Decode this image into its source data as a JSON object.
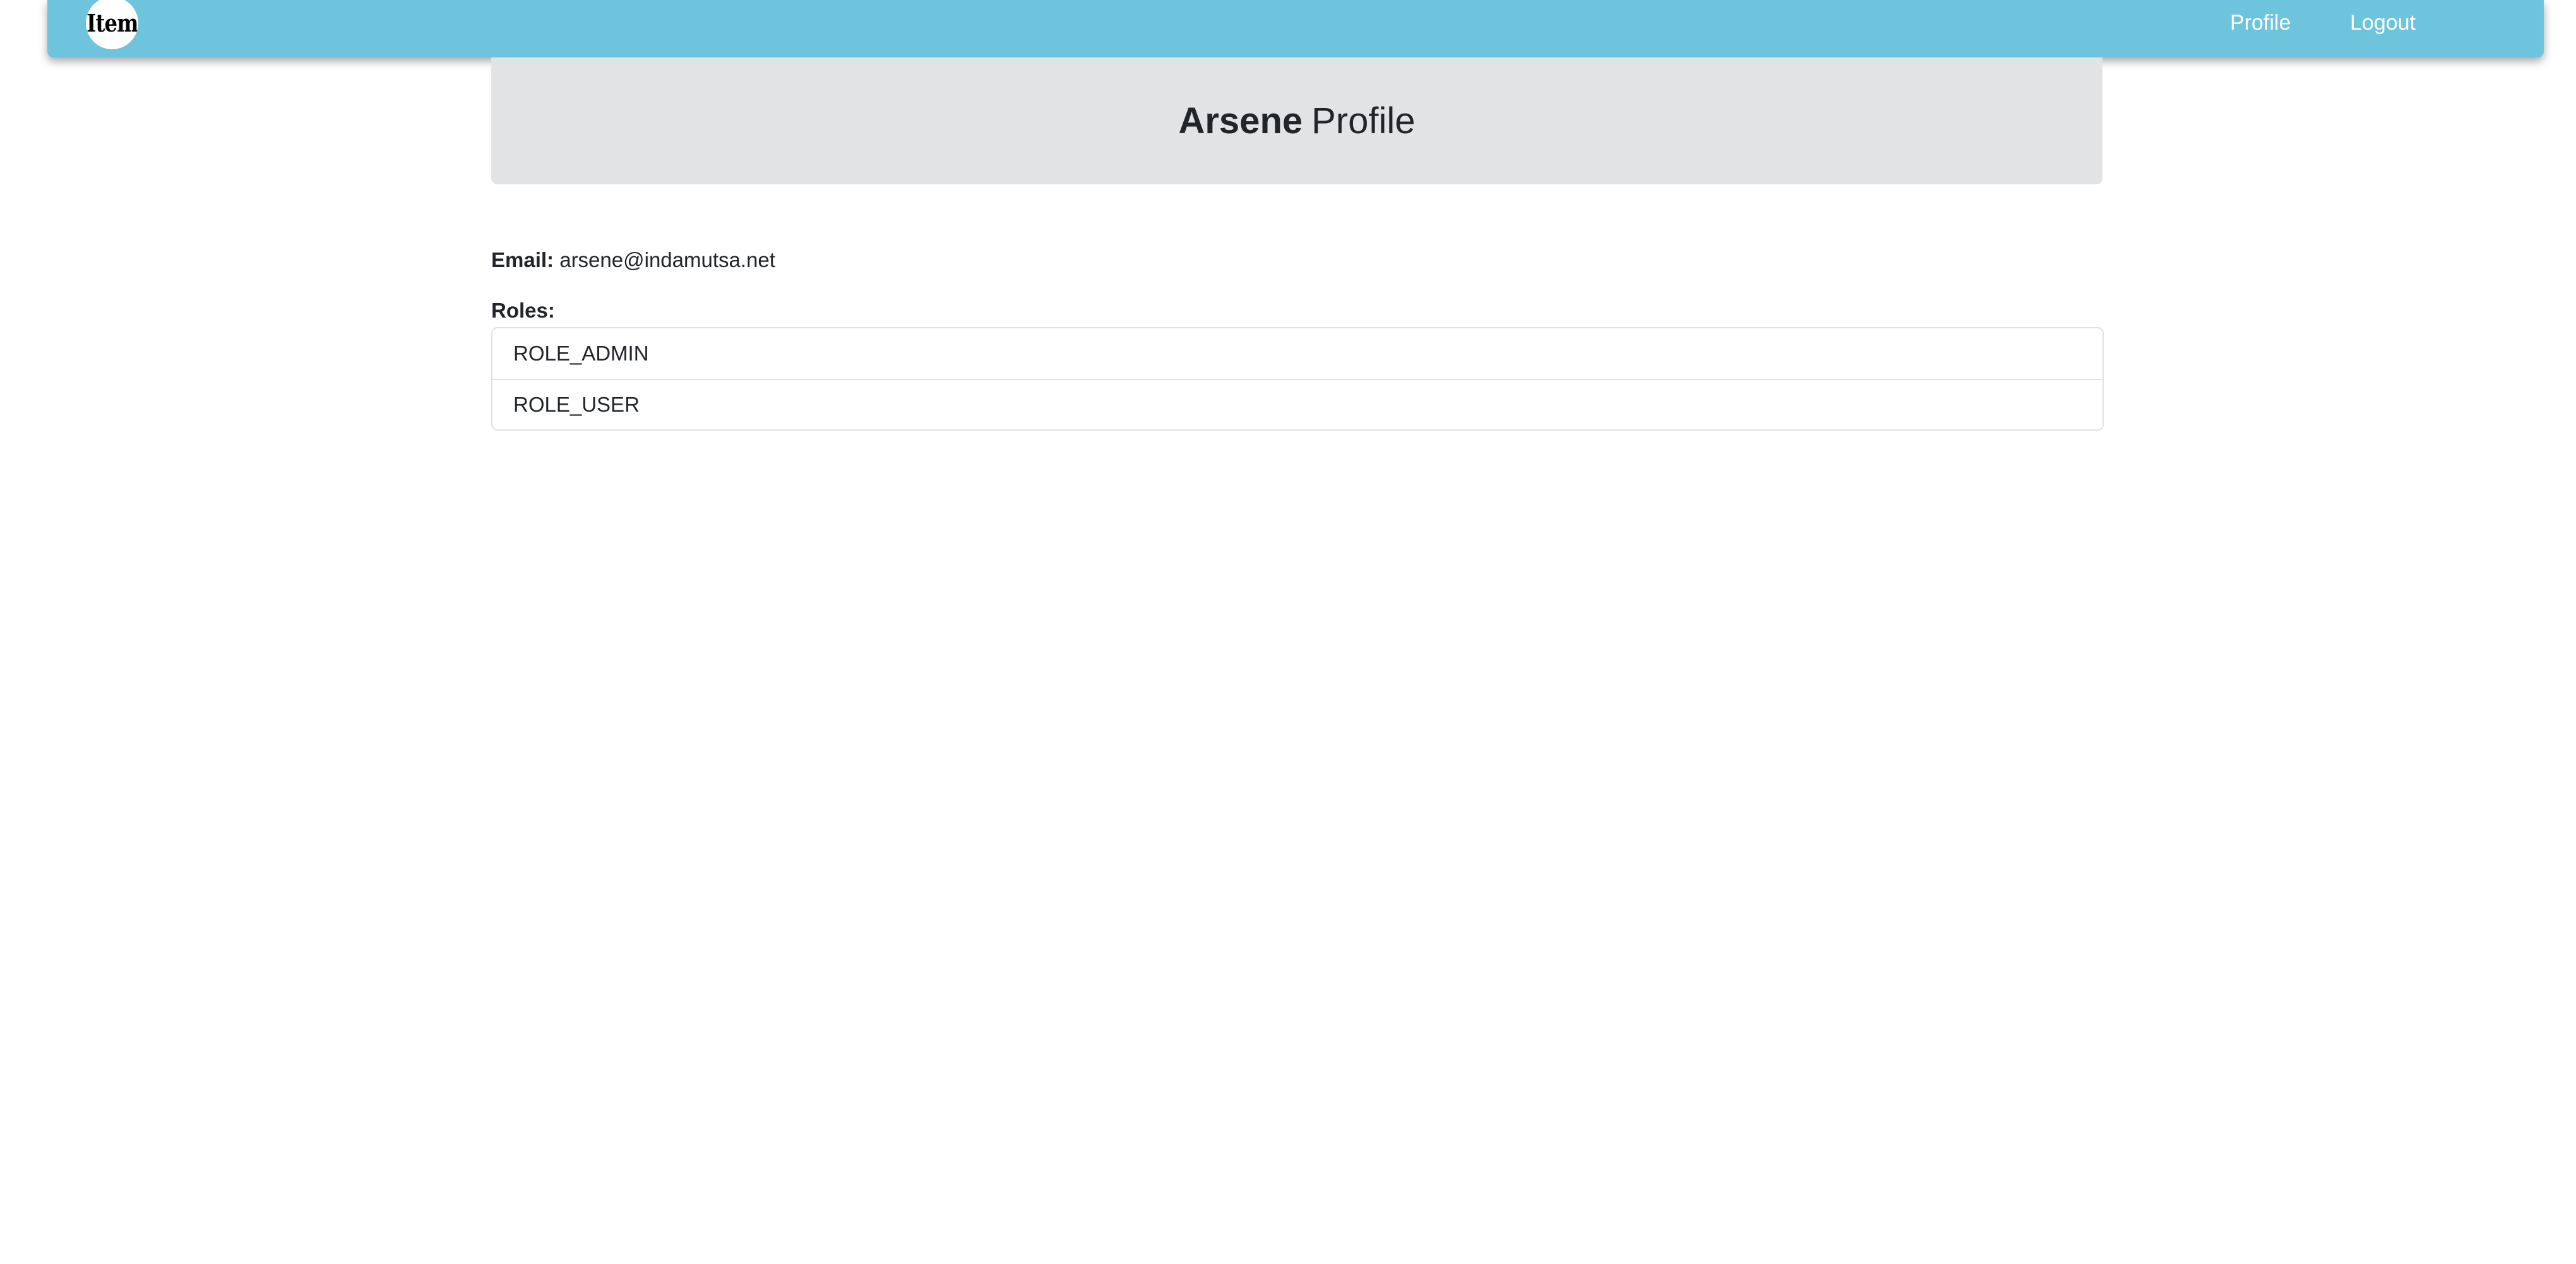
{
  "navbar": {
    "logo_text": "Item",
    "links": [
      {
        "label": "Profile"
      },
      {
        "label": "Logout"
      }
    ],
    "background": "#6fc4dd"
  },
  "profile": {
    "name": "Arsene",
    "title_suffix": "Profile",
    "email_label": "Email:",
    "email": "arsene@indamutsa.net",
    "roles_label": "Roles:",
    "roles": [
      "ROLE_ADMIN",
      "ROLE_USER"
    ]
  },
  "colors": {
    "header_card": "#e2e3e5",
    "border": "#dee2e6"
  }
}
